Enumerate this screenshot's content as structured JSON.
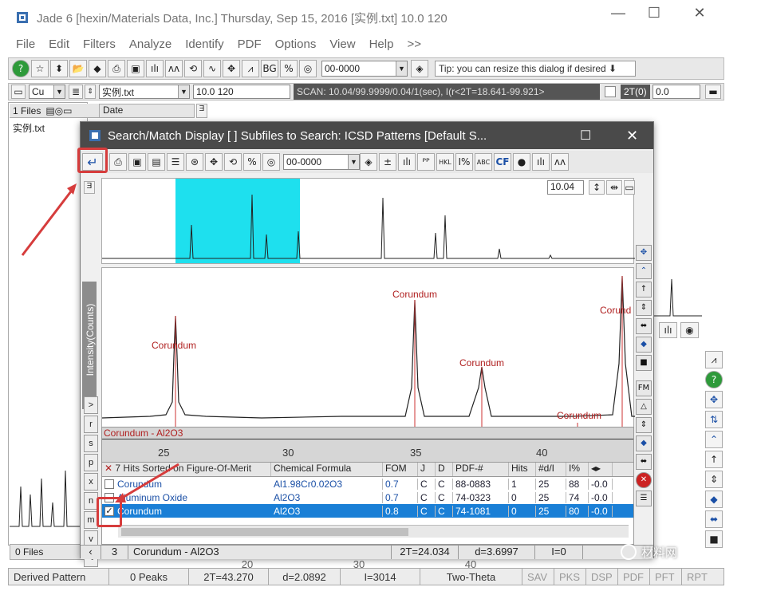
{
  "window": {
    "title": "Jade 6 [hexin/Materials Data, Inc.] Thursday, Sep 15, 2016 [实例.txt] 10.0     120",
    "minimize": "—",
    "maximize": "☐",
    "close": "✕"
  },
  "menu": [
    "File",
    "Edit",
    "Filters",
    "Analyze",
    "Identify",
    "PDF",
    "Options",
    "View",
    "Help",
    ">>"
  ],
  "toolbar": {
    "pdf_combo": "00-0000",
    "tip": "Tip: you can resize this dialog if desired ⬇"
  },
  "toolbar2": {
    "element_combo": "Cu",
    "file_combo": "实例.txt",
    "range_value": "10.0      120",
    "scan_info": "SCAN: 10.04/99.9999/0.04/1(sec), I(r<2T=18.641-99.921>",
    "twotheta_label": "2T(0)",
    "twotheta_value": "0.0"
  },
  "left_panel": {
    "files_label": "1 Files",
    "date_label": "Date",
    "file_item": "实例.txt",
    "zero_files": "0 Files"
  },
  "dialog": {
    "title": "Search/Match Display [ ] Subfiles to Search: ICSD Patterns [Default S...",
    "pdf_combo": "00-0000",
    "zoom_value": "10.04",
    "ylabel": "Intensity(Counts)",
    "peak_labels": [
      "Corundum",
      "Corundum",
      "Corundum",
      "Corund",
      "Corundum"
    ],
    "phase_label": "Corundum - Al2O3",
    "x_ticks": [
      "25",
      "30",
      "35",
      "40"
    ],
    "side_letters": [
      ">",
      "r",
      "s",
      "p",
      "x",
      "n",
      "m",
      "v",
      "<"
    ],
    "table_title": "7 Hits Sorted on Figure-Of-Merit",
    "columns": [
      "Chemical Formula",
      "FOM",
      "J",
      "D",
      "PDF-#",
      "Hits",
      "#d/I",
      "I%",
      "◂▸"
    ],
    "rows": [
      {
        "name": "Corundum",
        "formula": "Al1.98Cr0.02O3",
        "fom": "0.7",
        "j": "C",
        "d": "C",
        "pdf": "88-0883",
        "hits": "1",
        "di": "25",
        "ip": "88",
        "x": "-0.0"
      },
      {
        "name": "Aluminum Oxide",
        "formula": "Al2O3",
        "fom": "0.7",
        "j": "C",
        "d": "C",
        "pdf": "74-0323",
        "hits": "0",
        "di": "25",
        "ip": "74",
        "x": "-0.0"
      },
      {
        "name": "Corundum",
        "formula": "Al2O3",
        "fom": "0.8",
        "j": "C",
        "d": "C",
        "pdf": "74-1081",
        "hits": "0",
        "di": "25",
        "ip": "80",
        "x": "-0.0"
      }
    ],
    "bottom": {
      "count": "3",
      "phase": "Corundum - Al2O3",
      "twotheta": "2T=24.034",
      "d": "d=3.6997",
      "i": "I=0"
    }
  },
  "statusbar": {
    "derived": "Derived Pattern",
    "peaks": "0 Peaks",
    "twotheta": "2T=43.270",
    "d": "d=2.0892",
    "i": "I=3014",
    "mode": "Two-Theta",
    "buttons": [
      "SAV",
      "PKS",
      "DSP",
      "PDF",
      "PFT",
      "RPT"
    ]
  },
  "background_ticks": [
    "20",
    "30",
    "40"
  ],
  "watermark": "材料网"
}
